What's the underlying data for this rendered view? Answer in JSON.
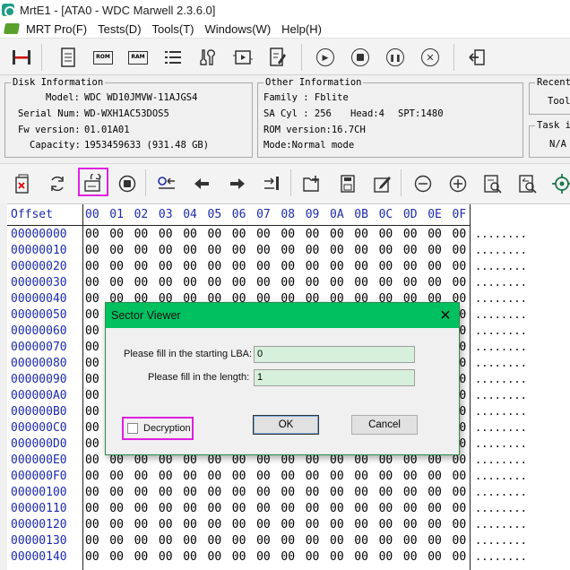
{
  "window": {
    "title": "MrtE1 - [ATA0 - WDC Marwell 2.3.6.0]"
  },
  "menu": {
    "items": [
      {
        "label": "MRT Pro(F)"
      },
      {
        "label": "Tests(D)"
      },
      {
        "label": "Tools(T)"
      },
      {
        "label": "Windows(W)"
      },
      {
        "label": "Help(H)"
      }
    ]
  },
  "toolbar": {
    "rom_label": "ROM",
    "ram_label": "RAM"
  },
  "disk_info": {
    "title": "Disk Information",
    "model_label": "Model:",
    "model": "WDC WD10JMVW-11AJGS4",
    "serial_label": "Serial Num:",
    "serial": "WD-WXH1AC53DOS5",
    "fw_label": "Fw version:",
    "fw": "01.01A01",
    "capacity_label": "Capacity:",
    "capacity": "1953459633 (931.48 GB)"
  },
  "other_info": {
    "title": "Other Information",
    "family": "Family  : Fblite",
    "sa_cyl": "SA Cyl  : 256",
    "head": "Head:4",
    "spt": "SPT:1480",
    "rom_version": "ROM version:16.7CH",
    "mode": "Mode:Normal mode"
  },
  "recent": {
    "title": "Recent",
    "item": "Tool"
  },
  "task": {
    "title": "Task i",
    "value": "N/A"
  },
  "hex": {
    "offset_header": "Offset",
    "columns": [
      "00",
      "01",
      "02",
      "03",
      "04",
      "05",
      "06",
      "07",
      "08",
      "09",
      "0A",
      "0B",
      "0C",
      "0D",
      "0E",
      "0F"
    ],
    "offsets": [
      "00000000",
      "00000010",
      "00000020",
      "00000030",
      "00000040",
      "00000050",
      "00000060",
      "00000070",
      "00000080",
      "00000090",
      "000000A0",
      "000000B0",
      "000000C0",
      "000000D0",
      "000000E0",
      "000000F0",
      "00000100",
      "00000110",
      "00000120",
      "00000130",
      "00000140"
    ],
    "row_bytes": "00 00 00 00 00 00 00 00 00 00 00 00 00 00 00 00",
    "row_ascii": "........"
  },
  "dialog": {
    "title": "Sector Viewer",
    "close_glyph": "✕",
    "lba_label": "Please fill in the starting LBA:",
    "lba_value": "0",
    "length_label": "Please fill in the length:",
    "length_value": "1",
    "decryption_label": "Decryption",
    "ok_label": "OK",
    "cancel_label": "Cancel"
  },
  "colors": {
    "dialog_title": "#00c060",
    "highlight": "#e020e0",
    "offset_text": "#1c2ba8",
    "field_bg": "#d6f0dc"
  }
}
